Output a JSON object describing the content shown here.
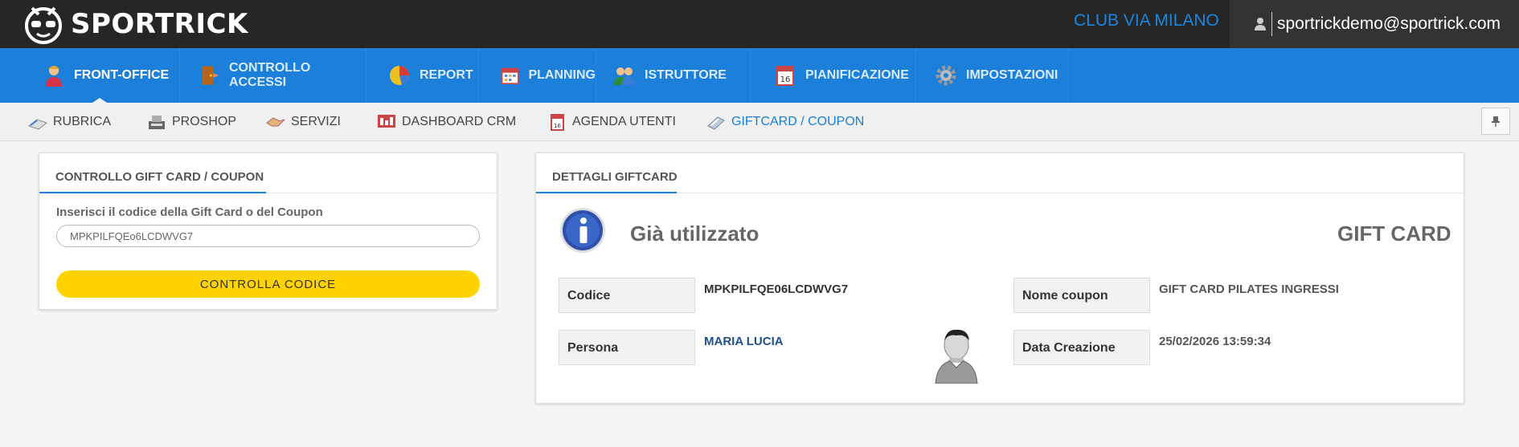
{
  "app": {
    "brand": "SPORTRICK",
    "club": "CLUB VIA MILANO",
    "user_email": "sportrickdemo@sportrick.com"
  },
  "main_nav": [
    {
      "label": "FRONT-OFFICE",
      "icon": "receptionist-icon",
      "active": true
    },
    {
      "label": "CONTROLLO ACCESSI",
      "icon": "door-access-icon",
      "active": false
    },
    {
      "label": "REPORT",
      "icon": "pie-chart-icon",
      "active": false
    },
    {
      "label": "PLANNING",
      "icon": "calendar-grid-icon",
      "active": false
    },
    {
      "label": "ISTRUTTORE",
      "icon": "instructors-icon",
      "active": false
    },
    {
      "label": "PIANIFICAZIONE",
      "icon": "calendar-icon",
      "active": false
    },
    {
      "label": "IMPOSTAZIONI",
      "icon": "gear-icon",
      "active": false
    }
  ],
  "sub_nav": [
    {
      "label": "RUBRICA",
      "icon": "address-book-icon",
      "active": false
    },
    {
      "label": "PROSHOP",
      "icon": "cash-register-icon",
      "active": false
    },
    {
      "label": "SERVIZI",
      "icon": "services-icon",
      "active": false
    },
    {
      "label": "DASHBOARD CRM",
      "icon": "dashboard-icon",
      "active": false
    },
    {
      "label": "AGENDA UTENTI",
      "icon": "agenda-icon",
      "active": false
    },
    {
      "label": "GIFTCARD / COUPON",
      "icon": "giftcard-icon",
      "active": true
    }
  ],
  "check_panel": {
    "title": "CONTROLLO GIFT CARD / COUPON",
    "input_label": "Inserisci il codice della Gift Card o del Coupon",
    "input_value": "MPKPILFQEo6LCDWVG7",
    "button_label": "CONTROLLA CODICE"
  },
  "details_panel": {
    "title": "DETTAGLI GIFTCARD",
    "status": "Già utilizzato",
    "type": "GIFT CARD",
    "fields": {
      "codice_label": "Codice",
      "codice_value": "MPKPILFQE06LCDWVG7",
      "nome_label": "Nome coupon",
      "nome_value": "GIFT CARD PILATES INGRESSI",
      "persona_label": "Persona",
      "persona_value": "MARIA LUCIA",
      "data_label": "Data Creazione",
      "data_value": "25/02/2026 13:59:34"
    }
  },
  "colors": {
    "topbar": "#262626",
    "nav_blue": "#1c7fd9",
    "accent_link": "#1b86e0",
    "button_yellow": "#ffd300"
  }
}
